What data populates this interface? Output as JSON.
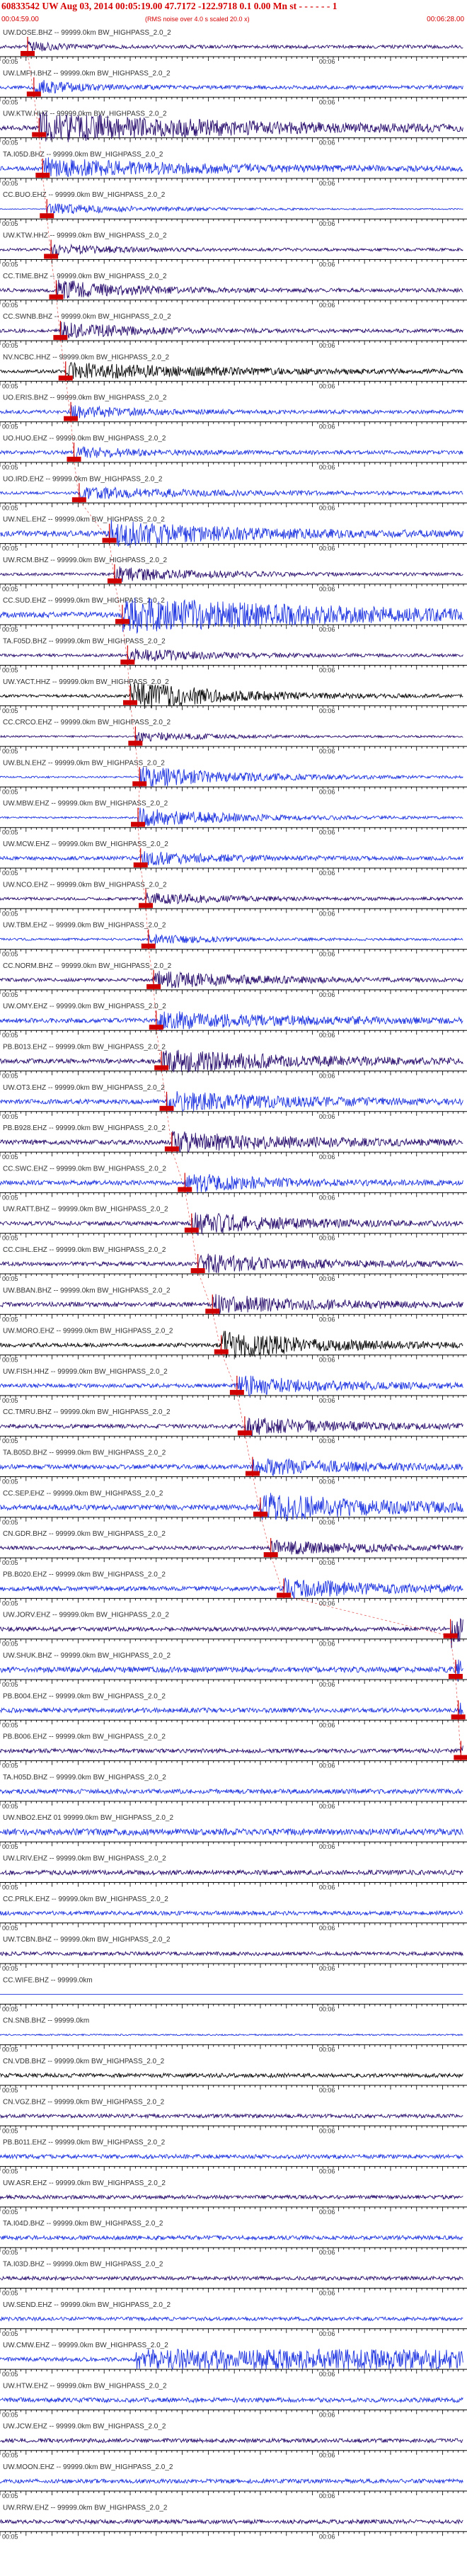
{
  "header": {
    "title": "60833542 UW Aug 03, 2014 00:05:19.00   47.7172  -122.9718  0.1 0.00 Mn st  - -  - -  - -  1",
    "start_time": "00:04:59.00",
    "note": "(RMS noise over 4.0 s scaled 20.0 x)",
    "end_time": "00:06:28.00"
  },
  "colors": {
    "trace_a": "#1f35e0",
    "trace_b": "#2a0f6e",
    "trace_c": "#0a0a0a",
    "pick": "#d00000",
    "grid": "#000000",
    "text": "#333333"
  },
  "chart_data": {
    "type": "seismogram",
    "x_range_seconds": [
      0,
      89
    ],
    "first_tick": "00:05",
    "second_tick": "00:06",
    "tick_labels": [
      "00:05",
      "00:06"
    ],
    "pick_marker": "P",
    "traces": [
      {
        "station": "UW.DOSE.BHZ",
        "label": "UW.DOSE.BHZ -- 99999.0km BW_HIGHPASS_2.0_2",
        "color": "b",
        "pick": 5.3,
        "event": 10,
        "onset_amp": 0.5,
        "noise": 0.18
      },
      {
        "station": "UW.LMFH.BHZ",
        "label": "UW.LMFH.BHZ -- 99999.0km BW_HIGHPASS_2.0_2",
        "color": "a",
        "pick": 6.5,
        "event": 12,
        "onset_amp": 0.8,
        "noise": 0.2
      },
      {
        "station": "UW.KTW.HHZ",
        "label": "UW.KTW.HHZ -- 99999.0km BW_HIGHPASS_2.0_2",
        "color": "b",
        "pick": 7.5,
        "event": 60,
        "onset_amp": 1.6,
        "noise": 0.25
      },
      {
        "station": "TA.I05D.BHZ",
        "label": "TA.I05D.BHZ -- 99999.0km BW_HIGHPASS_2.0_2",
        "color": "a",
        "pick": 8.2,
        "event": 45,
        "onset_amp": 1.0,
        "noise": 0.25
      },
      {
        "station": "CC.BUO.EHZ",
        "label": "CC.BUO.EHZ -- 99999.0km BW_HIGHPASS_2.0_2",
        "color": "a",
        "pick": 9.0,
        "event": 34,
        "onset_amp": 0.6,
        "noise": 0.05
      },
      {
        "station": "UW.KTW.HHZ",
        "label": "UW.KTW.HHZ -- 99999.0km BW_HIGHPASS_2.0_2",
        "color": "b",
        "pick": 9.8,
        "event": 18,
        "onset_amp": 0.6,
        "noise": 0.15
      },
      {
        "station": "CC.TIME.BHZ",
        "label": "CC.TIME.BHZ -- 99999.0km BW_HIGHPASS_2.0_2",
        "color": "b",
        "pick": 10.8,
        "event": 20,
        "onset_amp": 1.1,
        "noise": 0.2
      },
      {
        "station": "CC.SWNB.BHZ",
        "label": "CC.SWNB.BHZ -- 99999.0km BW_HIGHPASS_2.0_2",
        "color": "b",
        "pick": 11.6,
        "event": 22,
        "onset_amp": 0.9,
        "noise": 0.18
      },
      {
        "station": "NV.NCBC.HHZ",
        "label": "NV.NCBC.HHZ -- 99999.0km BW_HIGHPASS_2.0_2",
        "color": "c",
        "pick": 12.6,
        "event": 44,
        "onset_amp": 0.9,
        "noise": 0.18
      },
      {
        "station": "UO.ERIS.BHZ",
        "label": "UO.ERIS.BHZ -- 99999.0km BW_HIGHPASS_2.0_2",
        "color": "a",
        "pick": 13.6,
        "event": 20,
        "onset_amp": 0.6,
        "noise": 0.2
      },
      {
        "station": "UO.HUO.EHZ",
        "label": "UO.HUO.EHZ -- 99999.0km BW_HIGHPASS_2.0_2",
        "color": "a",
        "pick": 14.2,
        "event": 20,
        "onset_amp": 0.6,
        "noise": 0.2
      },
      {
        "station": "UO.IRD.EHZ",
        "label": "UO.IRD.EHZ -- 99999.0km BW_HIGHPASS_2.0_2",
        "color": "a",
        "pick": 15.2,
        "event": 40,
        "onset_amp": 0.6,
        "noise": 0.15
      },
      {
        "station": "UW.NEL.EHZ",
        "label": "UW.NEL.EHZ -- 99999.0km BW_HIGHPASS_2.0_2",
        "color": "a",
        "pick": 21.0,
        "event": 40,
        "onset_amp": 1.2,
        "noise": 0.3
      },
      {
        "station": "UW.RCM.BHZ",
        "label": "UW.RCM.BHZ -- 99999.0km BW_HIGHPASS_2.0_2",
        "color": "b",
        "pick": 22.0,
        "event": 26,
        "onset_amp": 0.8,
        "noise": 0.15
      },
      {
        "station": "CC.SUD.EHZ",
        "label": "CC.SUD.EHZ -- 99999.0km BW_HIGHPASS_2.0_2",
        "color": "a",
        "pick": 23.5,
        "event": 70,
        "onset_amp": 1.8,
        "noise": 0.3
      },
      {
        "station": "TA.F05D.BHZ",
        "label": "TA.F05D.BHZ -- 99999.0km BW_HIGHPASS_2.0_2",
        "color": "b",
        "pick": 24.5,
        "event": 26,
        "onset_amp": 0.7,
        "noise": 0.15
      },
      {
        "station": "UW.YACT.HHZ",
        "label": "UW.YACT.HHZ -- 99999.0km BW_HIGHPASS_2.0_2",
        "color": "c",
        "pick": 25.0,
        "event": 28,
        "onset_amp": 1.6,
        "noise": 0.15
      },
      {
        "station": "CC.CRCO.EHZ",
        "label": "CC.CRCO.EHZ -- 99999.0km BW_HIGHPASS_2.0_2",
        "color": "b",
        "pick": 26.0,
        "event": 22,
        "onset_amp": 0.5,
        "noise": 0.1
      },
      {
        "station": "UW.BLN.EHZ",
        "label": "UW.BLN.EHZ -- 99999.0km BW_HIGHPASS_2.0_2",
        "color": "a",
        "pick": 26.8,
        "event": 30,
        "onset_amp": 1.2,
        "noise": 0.1
      },
      {
        "station": "UW.MBW.EHZ",
        "label": "UW.MBW.EHZ -- 99999.0km BW_HIGHPASS_2.0_2",
        "color": "a",
        "pick": 26.5,
        "event": 30,
        "onset_amp": 1.0,
        "noise": 0.1
      },
      {
        "station": "UW.MCW.EHZ",
        "label": "UW.MCW.EHZ -- 99999.0km BW_HIGHPASS_2.0_2",
        "color": "a",
        "pick": 27.0,
        "event": 24,
        "onset_amp": 0.7,
        "noise": 0.2
      },
      {
        "station": "UW.NCO.EHZ",
        "label": "UW.NCO.EHZ -- 99999.0km BW_HIGHPASS_2.0_2",
        "color": "b",
        "pick": 28.0,
        "event": 24,
        "onset_amp": 0.6,
        "noise": 0.15
      },
      {
        "station": "UW.TBM.EHZ",
        "label": "UW.TBM.EHZ -- 99999.0km BW_HIGHPASS_2.0_2",
        "color": "a",
        "pick": 28.5,
        "event": 20,
        "onset_amp": 0.5,
        "noise": 0.12
      },
      {
        "station": "CC.NORM.BHZ",
        "label": "CC.NORM.BHZ -- 99999.0km BW_HIGHPASS_2.0_2",
        "color": "b",
        "pick": 29.5,
        "event": 30,
        "onset_amp": 0.9,
        "noise": 0.18
      },
      {
        "station": "UW.OMY.EHZ",
        "label": "UW.OMY.EHZ -- 99999.0km BW_HIGHPASS_2.0_2",
        "color": "a",
        "pick": 30.0,
        "event": 40,
        "onset_amp": 0.9,
        "noise": 0.25
      },
      {
        "station": "PB.B013.EHZ",
        "label": "PB.B013.EHZ -- 99999.0km BW_HIGHPASS_2.0_2",
        "color": "b",
        "pick": 31.0,
        "event": 40,
        "onset_amp": 1.2,
        "noise": 0.25
      },
      {
        "station": "UW.OT3.EHZ",
        "label": "UW.OT3.EHZ -- 99999.0km BW_HIGHPASS_2.0_2",
        "color": "a",
        "pick": 32.0,
        "event": 40,
        "onset_amp": 1.0,
        "noise": 0.25
      },
      {
        "station": "PB.B928.EHZ",
        "label": "PB.B928.EHZ -- 99999.0km BW_HIGHPASS_2.0_2",
        "color": "b",
        "pick": 33.0,
        "event": 40,
        "onset_amp": 1.0,
        "noise": 0.25
      },
      {
        "station": "CC.SWC.EHZ",
        "label": "CC.SWC.EHZ -- 99999.0km BW_HIGHPASS_2.0_2",
        "color": "a",
        "pick": 35.5,
        "event": 24,
        "onset_amp": 1.0,
        "noise": 0.25
      },
      {
        "station": "UW.RATT.BHZ",
        "label": "UW.RATT.BHZ -- 99999.0km BW_HIGHPASS_2.0_2",
        "color": "b",
        "pick": 36.8,
        "event": 28,
        "onset_amp": 1.2,
        "noise": 0.22
      },
      {
        "station": "CC.CIHL.EHZ",
        "label": "CC.CIHL.EHZ -- 99999.0km BW_HIGHPASS_2.0_2",
        "color": "b",
        "pick": 38.0,
        "event": 30,
        "onset_amp": 1.0,
        "noise": 0.22
      },
      {
        "station": "UW.BBAN.BHZ",
        "label": "UW.BBAN.BHZ -- 99999.0km BW_HIGHPASS_2.0_2",
        "color": "b",
        "pick": 40.8,
        "event": 30,
        "onset_amp": 1.0,
        "noise": 0.25
      },
      {
        "station": "UW.MORO.EHZ",
        "label": "UW.MORO.EHZ -- 99999.0km BW_HIGHPASS_2.0_2",
        "color": "c",
        "pick": 42.5,
        "event": 30,
        "onset_amp": 1.4,
        "noise": 0.22
      },
      {
        "station": "UW.FISH.HHZ",
        "label": "UW.FISH.HHZ -- 99999.0km BW_HIGHPASS_2.0_2",
        "color": "a",
        "pick": 45.5,
        "event": 30,
        "onset_amp": 1.0,
        "noise": 0.22
      },
      {
        "station": "CC.TMRU.BHZ",
        "label": "CC.TMRU.BHZ -- 99999.0km BW_HIGHPASS_2.0_2",
        "color": "b",
        "pick": 47.0,
        "event": 30,
        "onset_amp": 0.9,
        "noise": 0.22
      },
      {
        "station": "TA.B05D.BHZ",
        "label": "TA.B05D.BHZ -- 99999.0km BW_HIGHPASS_2.0_2",
        "color": "a",
        "pick": 48.5,
        "event": 30,
        "onset_amp": 0.9,
        "noise": 0.25
      },
      {
        "station": "CC.SEP.EHZ",
        "label": "CC.SEP.EHZ -- 99999.0km BW_HIGHPASS_2.0_2",
        "color": "a",
        "pick": 50.0,
        "event": 35,
        "onset_amp": 1.5,
        "noise": 0.3
      },
      {
        "station": "CN.GDR.BHZ",
        "label": "CN.GDR.BHZ -- 99999.0km BW_HIGHPASS_2.0_2",
        "color": "b",
        "pick": 52.0,
        "event": 30,
        "onset_amp": 0.7,
        "noise": 0.2
      },
      {
        "station": "PB.B020.EHZ",
        "label": "PB.B020.EHZ -- 99999.0km BW_HIGHPASS_2.0_2",
        "color": "a",
        "pick": 54.5,
        "event": 30,
        "onset_amp": 1.0,
        "noise": 0.25
      },
      {
        "station": "UW.JORV.EHZ",
        "label": "UW.JORV.EHZ -- 99999.0km BW_HIGHPASS_2.0_2",
        "color": "b",
        "pick": 86.5,
        "event": 5,
        "onset_amp": 2.0,
        "noise": 0.22
      },
      {
        "station": "UW.SHUK.BHZ",
        "label": "UW.SHUK.BHZ -- 99999.0km BW_HIGHPASS_2.0_2",
        "color": "a",
        "pick": 87.5,
        "event": 3,
        "onset_amp": 1.2,
        "noise": 0.3
      },
      {
        "station": "PB.B004.EHZ",
        "label": "PB.B004.EHZ -- 99999.0km BW_HIGHPASS_2.0_2",
        "color": "a",
        "pick": 88.0,
        "event": 2,
        "onset_amp": 0.8,
        "noise": 0.25
      },
      {
        "station": "PB.B006.EHZ",
        "label": "PB.B006.EHZ -- 99999.0km BW_HIGHPASS_2.0_2",
        "color": "b",
        "pick": 88.5,
        "event": 2,
        "onset_amp": 0.8,
        "noise": 0.22
      },
      {
        "station": "TA.H05D.BHZ",
        "label": "TA.H05D.BHZ -- 99999.0km BW_HIGHPASS_2.0_2",
        "color": "a",
        "pick": null,
        "event": 0,
        "onset_amp": 0,
        "noise": 0.25
      },
      {
        "station": "UW.NBO2.EHZ",
        "label": "UW.NBO2.EHZ 01 99999.0km BW_HIGHPASS_2.0_2",
        "color": "a",
        "pick": null,
        "event": 0,
        "onset_amp": 0,
        "noise": 0.35
      },
      {
        "station": "UW.LRIV.EHZ",
        "label": "UW.LRIV.EHZ -- 99999.0km BW_HIGHPASS_2.0_2",
        "color": "b",
        "pick": null,
        "event": 0,
        "onset_amp": 0,
        "noise": 0.25
      },
      {
        "station": "CC.PRLK.EHZ",
        "label": "CC.PRLK.EHZ -- 99999.0km BW_HIGHPASS_2.0_2",
        "color": "a",
        "pick": null,
        "event": 0,
        "onset_amp": 0,
        "noise": 0.22
      },
      {
        "station": "UW.TCBN.BHZ",
        "label": "UW.TCBN.BHZ -- 99999.0km BW_HIGHPASS_2.0_2",
        "color": "b",
        "pick": null,
        "event": 0,
        "onset_amp": 0,
        "noise": 0.2
      },
      {
        "station": "CC.WIFE.BHZ",
        "label": "CC.WIFE.BHZ -- 99999.0km",
        "color": "a",
        "pick": null,
        "event": 0,
        "onset_amp": 0,
        "noise": 0.0
      },
      {
        "station": "CN.SNB.BHZ",
        "label": "CN.SNB.BHZ -- 99999.0km",
        "color": "a",
        "pick": null,
        "event": 0,
        "onset_amp": 0,
        "noise": 0.08
      },
      {
        "station": "CN.VDB.BHZ",
        "label": "CN.VDB.BHZ -- 99999.0km BW_HIGHPASS_2.0_2",
        "color": "c",
        "pick": null,
        "event": 0,
        "onset_amp": 0,
        "noise": 0.22
      },
      {
        "station": "CN.VGZ.BHZ",
        "label": "CN.VGZ.BHZ -- 99999.0km BW_HIGHPASS_2.0_2",
        "color": "b",
        "pick": null,
        "event": 0,
        "onset_amp": 0,
        "noise": 0.2
      },
      {
        "station": "PB.B011.EHZ",
        "label": "PB.B011.EHZ -- 99999.0km BW_HIGHPASS_2.0_2",
        "color": "a",
        "pick": null,
        "event": 0,
        "onset_amp": 0,
        "noise": 0.22
      },
      {
        "station": "UW.ASR.EHZ",
        "label": "UW.ASR.EHZ -- 99999.0km BW_HIGHPASS_2.0_2",
        "color": "b",
        "pick": null,
        "event": 0,
        "onset_amp": 0,
        "noise": 0.2
      },
      {
        "station": "TA.I04D.BHZ",
        "label": "TA.I04D.BHZ -- 99999.0km BW_HIGHPASS_2.0_2",
        "color": "a",
        "pick": null,
        "event": 0,
        "onset_amp": 0,
        "noise": 0.22
      },
      {
        "station": "TA.I03D.BHZ",
        "label": "TA.I03D.BHZ -- 99999.0km BW_HIGHPASS_2.0_2",
        "color": "b",
        "pick": null,
        "event": 0,
        "onset_amp": 0,
        "noise": 0.2
      },
      {
        "station": "UW.SEND.EHZ",
        "label": "UW.SEND.EHZ -- 99999.0km BW_HIGHPASS_2.0_2",
        "color": "a",
        "pick": null,
        "event": 0,
        "onset_amp": 0,
        "noise": 0.2
      },
      {
        "station": "UW.CMW.EHZ",
        "label": "UW.CMW.EHZ -- 99999.0km BW_HIGHPASS_2.0_2",
        "color": "a",
        "pick": null,
        "event": 0,
        "onset_amp": 0,
        "noise": 0.22,
        "burst_start": 26
      },
      {
        "station": "UW.HTW.EHZ",
        "label": "UW.HTW.EHZ -- 99999.0km BW_HIGHPASS_2.0_2",
        "color": "a",
        "pick": null,
        "event": 0,
        "onset_amp": 0,
        "noise": 0.25
      },
      {
        "station": "UW.JCW.EHZ",
        "label": "UW.JCW.EHZ -- 99999.0km BW_HIGHPASS_2.0_2",
        "color": "b",
        "pick": null,
        "event": 0,
        "onset_amp": 0,
        "noise": 0.22
      },
      {
        "station": "UW.MOON.EHZ",
        "label": "UW.MOON.EHZ -- 99999.0km BW_HIGHPASS_2.0_2",
        "color": "a",
        "pick": null,
        "event": 0,
        "onset_amp": 0,
        "noise": 0.22
      },
      {
        "station": "UW.RRW.EHZ",
        "label": "UW.RRW.EHZ -- 99999.0km BW_HIGHPASS_2.0_2",
        "color": "b",
        "pick": null,
        "event": 0,
        "onset_amp": 0,
        "noise": 0.22
      }
    ]
  }
}
